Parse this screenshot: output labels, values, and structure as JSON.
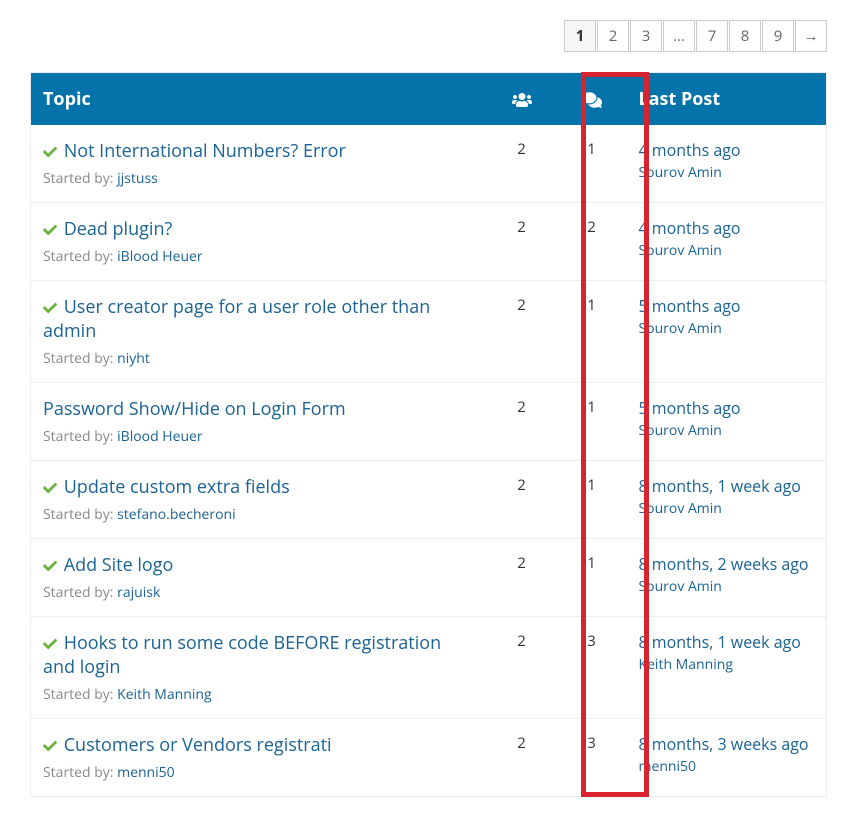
{
  "pagination": {
    "pages": [
      "1",
      "2",
      "3",
      "…",
      "7",
      "8",
      "9",
      "→"
    ],
    "current": "1"
  },
  "headers": {
    "topic": "Topic",
    "lastPost": "Last Post"
  },
  "labels": {
    "startedBy": "Started by: "
  },
  "topics": [
    {
      "resolved": true,
      "title": "Not International Numbers? Error",
      "author": "jjstuss",
      "voices": "2",
      "replies": "1",
      "lastPostTime": "4 months ago",
      "lastPostAuthor": "Sourov Amin"
    },
    {
      "resolved": true,
      "title": "Dead plugin?",
      "author": "iBlood Heuer",
      "voices": "2",
      "replies": "2",
      "lastPostTime": "4 months ago",
      "lastPostAuthor": "Sourov Amin"
    },
    {
      "resolved": true,
      "title": "User creator page for a user role other than admin",
      "author": "niyht",
      "voices": "2",
      "replies": "1",
      "lastPostTime": "5 months ago",
      "lastPostAuthor": "Sourov Amin"
    },
    {
      "resolved": false,
      "title": "Password Show/Hide on Login Form",
      "author": "iBlood Heuer",
      "voices": "2",
      "replies": "1",
      "lastPostTime": "5 months ago",
      "lastPostAuthor": "Sourov Amin"
    },
    {
      "resolved": true,
      "title": "Update custom extra fields",
      "author": "stefano.becheroni",
      "voices": "2",
      "replies": "1",
      "lastPostTime": "8 months, 1 week ago",
      "lastPostAuthor": "Sourov Amin"
    },
    {
      "resolved": true,
      "title": "Add Site logo",
      "author": "rajuisk",
      "voices": "2",
      "replies": "1",
      "lastPostTime": "8 months, 2 weeks ago",
      "lastPostAuthor": "Sourov Amin"
    },
    {
      "resolved": true,
      "title": "Hooks to run some code BEFORE registration and login",
      "author": "Keith Manning",
      "voices": "2",
      "replies": "3",
      "lastPostTime": "8 months, 1 week ago",
      "lastPostAuthor": "Keith Manning"
    },
    {
      "resolved": true,
      "title": "Customers or Vendors registrati",
      "author": "menni50",
      "voices": "2",
      "replies": "3",
      "lastPostTime": "8 months, 3 weeks ago",
      "lastPostAuthor": "menni50"
    }
  ]
}
